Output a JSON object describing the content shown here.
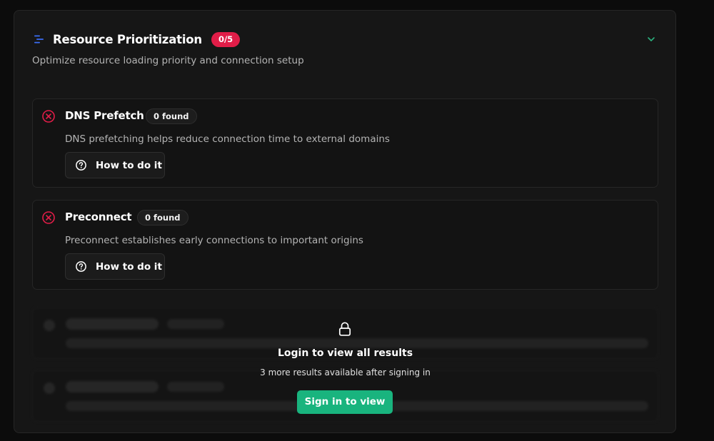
{
  "colors": {
    "accent_green": "#19b47e",
    "error_red": "#e11d48",
    "score_badge": "#e11d48",
    "icon_blue": "#3b6ef5",
    "chevron_green": "#2bb07d"
  },
  "section": {
    "title": "Resource Prioritization",
    "score_badge": "0/5",
    "subtitle": "Optimize resource loading priority and connection setup",
    "header_icon": "list-lines-icon",
    "toggle_icon": "chevron-down-icon"
  },
  "checks": [
    {
      "title": "DNS Prefetch",
      "badge": "0 found",
      "description": "DNS prefetching helps reduce connection time to external domains",
      "status_icon": "x-circle-icon",
      "action_label": "How to do it"
    },
    {
      "title": "Preconnect",
      "badge": "0 found",
      "description": "Preconnect establishes early connections to important origins",
      "status_icon": "x-circle-icon",
      "action_label": "How to do it"
    }
  ],
  "locked": {
    "icon": "lock-icon",
    "title": "Login to view all results",
    "subtitle": "3 more results available after signing in",
    "button_label": "Sign in to view"
  }
}
